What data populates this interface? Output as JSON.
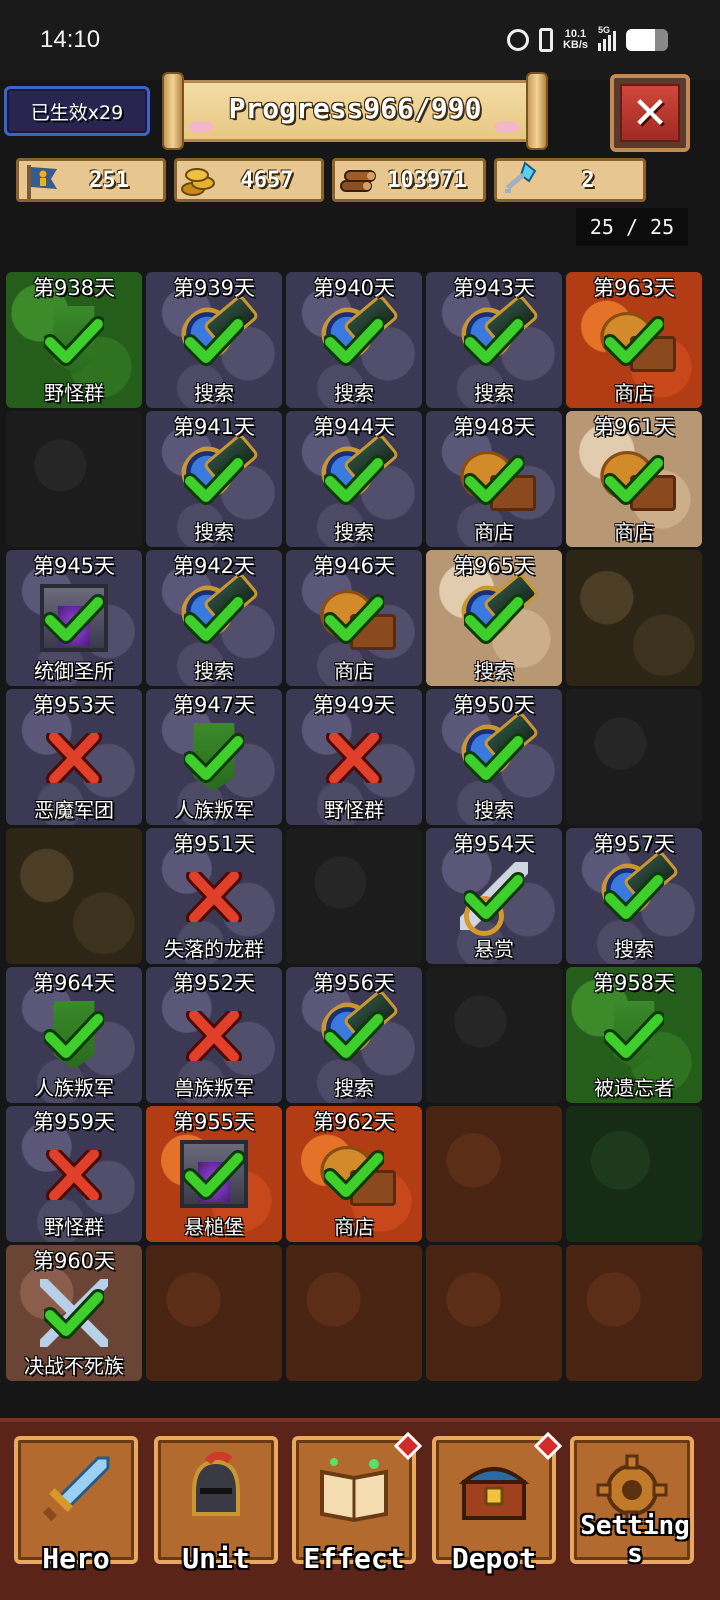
{
  "status_bar": {
    "time": "14:10",
    "net_speed_value": "10.1",
    "net_speed_unit": "KB/s",
    "network": "5G",
    "battery_level": 0.7
  },
  "header": {
    "buff_badge": "已生效x29",
    "progress_text": "Progress966/990",
    "close_icon": "close-icon"
  },
  "resources": [
    {
      "name": "population",
      "icon": "person-flag-icon",
      "value": "251"
    },
    {
      "name": "gold",
      "icon": "coins-icon",
      "value": "4657"
    },
    {
      "name": "wood",
      "icon": "logs-icon",
      "value": "103971"
    },
    {
      "name": "key",
      "icon": "crystal-key-icon",
      "value": "2"
    }
  ],
  "page_counter": "25 / 25",
  "tiles": [
    {
      "day": "第938天",
      "name": "野怪群",
      "terrain": "grass",
      "object": "banner",
      "status": "done"
    },
    {
      "day": "第939天",
      "name": "搜索",
      "terrain": "stone",
      "object": "scope",
      "status": "done"
    },
    {
      "day": "第940天",
      "name": "搜索",
      "terrain": "stone",
      "object": "scope",
      "status": "done"
    },
    {
      "day": "第943天",
      "name": "搜索",
      "terrain": "stone",
      "object": "scope",
      "status": "done"
    },
    {
      "day": "第963天",
      "name": "商店",
      "terrain": "lava",
      "object": "bag",
      "status": "done"
    },
    {
      "day": "",
      "name": "",
      "terrain": "dark",
      "object": "",
      "status": ""
    },
    {
      "day": "第941天",
      "name": "搜索",
      "terrain": "stone",
      "object": "scope",
      "status": "done"
    },
    {
      "day": "第944天",
      "name": "搜索",
      "terrain": "stone",
      "object": "scope",
      "status": "done"
    },
    {
      "day": "第948天",
      "name": "商店",
      "terrain": "stone",
      "object": "bag",
      "status": "done"
    },
    {
      "day": "第961天",
      "name": "商店",
      "terrain": "sand",
      "object": "bag",
      "status": "done"
    },
    {
      "day": "第945天",
      "name": "统御圣所",
      "terrain": "stone",
      "object": "shrine",
      "status": "done"
    },
    {
      "day": "第942天",
      "name": "搜索",
      "terrain": "stone",
      "object": "scope",
      "status": "done"
    },
    {
      "day": "第946天",
      "name": "商店",
      "terrain": "stone",
      "object": "bag",
      "status": "done"
    },
    {
      "day": "第965天",
      "name": "搜索",
      "terrain": "sand",
      "object": "scope",
      "status": "done"
    },
    {
      "day": "",
      "name": "",
      "terrain": "mud",
      "object": "",
      "status": ""
    },
    {
      "day": "第953天",
      "name": "恶魔军团",
      "terrain": "stone",
      "object": "",
      "status": "failed"
    },
    {
      "day": "第947天",
      "name": "人族叛军",
      "terrain": "stone",
      "object": "banner",
      "status": "done"
    },
    {
      "day": "第949天",
      "name": "野怪群",
      "terrain": "stone",
      "object": "",
      "status": "failed"
    },
    {
      "day": "第950天",
      "name": "搜索",
      "terrain": "stone",
      "object": "scope",
      "status": "done"
    },
    {
      "day": "",
      "name": "",
      "terrain": "dark",
      "object": "",
      "status": ""
    },
    {
      "day": "",
      "name": "",
      "terrain": "mud",
      "object": "",
      "status": ""
    },
    {
      "day": "第951天",
      "name": "失落的龙群",
      "terrain": "stone",
      "object": "",
      "status": "failed"
    },
    {
      "day": "",
      "name": "",
      "terrain": "dark",
      "object": "",
      "status": ""
    },
    {
      "day": "第954天",
      "name": "悬赏",
      "terrain": "stone",
      "object": "dagger",
      "status": "done"
    },
    {
      "day": "第957天",
      "name": "搜索",
      "terrain": "stone",
      "object": "scope",
      "status": "done"
    },
    {
      "day": "第964天",
      "name": "人族叛军",
      "terrain": "stone",
      "object": "banner",
      "status": "done"
    },
    {
      "day": "第952天",
      "name": "兽族叛军",
      "terrain": "stone",
      "object": "",
      "status": "failed"
    },
    {
      "day": "第956天",
      "name": "搜索",
      "terrain": "stone",
      "object": "scope",
      "status": "done"
    },
    {
      "day": "",
      "name": "",
      "terrain": "dark",
      "object": "",
      "status": ""
    },
    {
      "day": "第958天",
      "name": "被遗忘者",
      "terrain": "grass",
      "object": "banner",
      "status": "done"
    },
    {
      "day": "第959天",
      "name": "野怪群",
      "terrain": "stone",
      "object": "",
      "status": "failed"
    },
    {
      "day": "第955天",
      "name": "悬槌堡",
      "terrain": "lava",
      "object": "shrine",
      "status": "done"
    },
    {
      "day": "第962天",
      "name": "商店",
      "terrain": "lava",
      "object": "bag",
      "status": "done"
    },
    {
      "day": "",
      "name": "",
      "terrain": "dirt",
      "object": "",
      "status": ""
    },
    {
      "day": "",
      "name": "",
      "terrain": "darkgreen",
      "object": "",
      "status": ""
    },
    {
      "day": "第960天",
      "name": "决战不死族",
      "terrain": "rubble",
      "object": "swords",
      "status": "done"
    },
    {
      "day": "",
      "name": "",
      "terrain": "dirt",
      "object": "",
      "status": ""
    },
    {
      "day": "",
      "name": "",
      "terrain": "dirt",
      "object": "",
      "status": ""
    },
    {
      "day": "",
      "name": "",
      "terrain": "dirt",
      "object": "",
      "status": ""
    },
    {
      "day": "",
      "name": "",
      "terrain": "dirt",
      "object": "",
      "status": ""
    }
  ],
  "nav": [
    {
      "key": "hero",
      "label": "Hero",
      "icon": "sword-icon",
      "badge": false
    },
    {
      "key": "unit",
      "label": "Unit",
      "icon": "knight-helmet-icon",
      "badge": false
    },
    {
      "key": "effect",
      "label": "Effect",
      "icon": "spellbook-icon",
      "badge": true
    },
    {
      "key": "depot",
      "label": "Depot",
      "icon": "treasure-chest-icon",
      "badge": true
    },
    {
      "key": "settings",
      "label": "Settings",
      "icon": "gear-icon",
      "badge": false
    }
  ],
  "colors": {
    "done_check": "#3ecf2c",
    "failed_cross": "#e0402a",
    "panel_parchment": "#e8c68f",
    "nav_bar": "#5a2418"
  }
}
